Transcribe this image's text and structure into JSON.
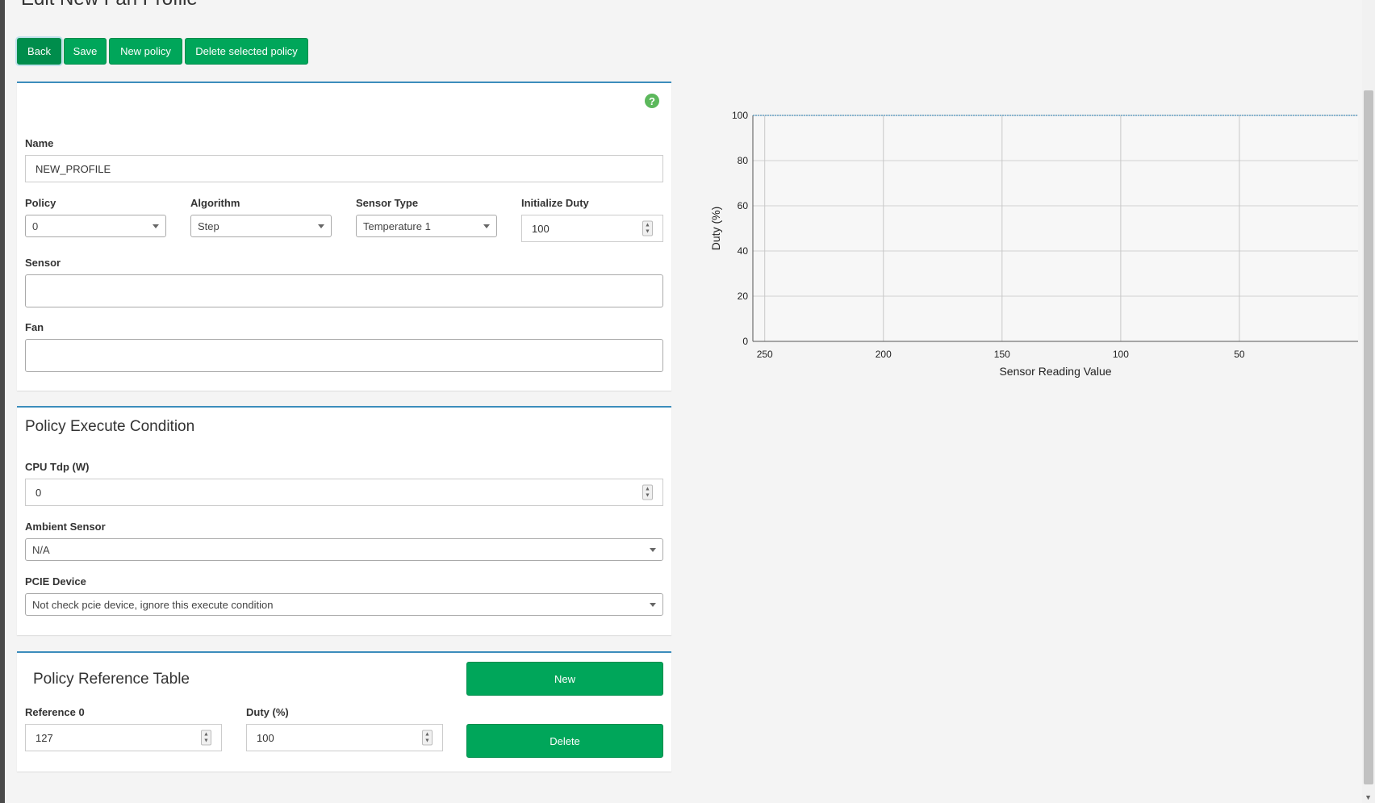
{
  "page": {
    "title": "Edit New Fan Profile"
  },
  "toolbar": {
    "back_label": "Back",
    "save_label": "Save",
    "new_policy_label": "New policy",
    "delete_policy_label": "Delete selected policy"
  },
  "profile_panel": {
    "help_icon": "question-circle-icon",
    "name_label": "Name",
    "name_value": "NEW_PROFILE",
    "policy_label": "Policy",
    "policy_value": "0",
    "algorithm_label": "Algorithm",
    "algorithm_value": "Step",
    "sensor_type_label": "Sensor Type",
    "sensor_type_value": "Temperature 1",
    "initialize_duty_label": "Initialize Duty",
    "initialize_duty_value": "100",
    "sensor_label": "Sensor",
    "sensor_value": "",
    "fan_label": "Fan",
    "fan_value": ""
  },
  "condition_panel": {
    "title": "Policy Execute Condition",
    "cpu_tdp_label": "CPU Tdp (W)",
    "cpu_tdp_value": "0",
    "ambient_label": "Ambient Sensor",
    "ambient_value": "N/A",
    "pcie_label": "PCIE Device",
    "pcie_value": "Not check pcie device, ignore this execute condition"
  },
  "reference_panel": {
    "title": "Policy Reference Table",
    "new_label": "New",
    "delete_label": "Delete",
    "reference_label": "Reference 0",
    "reference_value": "127",
    "duty_label": "Duty (%)",
    "duty_value": "100"
  },
  "chart_data": {
    "type": "line",
    "xlabel": "Sensor Reading Value",
    "ylabel": "Duty (%)",
    "x_ticks": [
      250,
      200,
      150,
      100,
      50
    ],
    "y_ticks": [
      0,
      20,
      40,
      60,
      80,
      100
    ],
    "xlim": [
      255,
      0
    ],
    "ylim": [
      0,
      100
    ],
    "x_reversed": true,
    "grid": true,
    "series": [
      {
        "x": [
          255,
          0
        ],
        "y": [
          100,
          100
        ],
        "color": "#4a90b8"
      }
    ]
  }
}
